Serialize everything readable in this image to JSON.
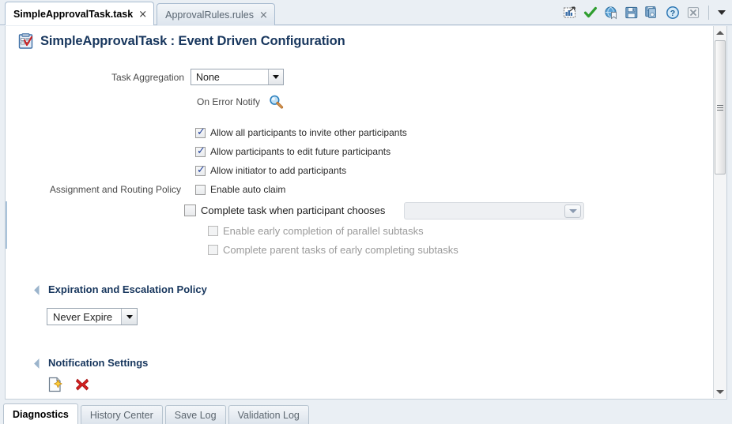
{
  "window": {
    "document_tabs": [
      {
        "label": "SimpleApprovalTask.task",
        "close": "×",
        "active": true
      },
      {
        "label": "ApprovalRules.rules",
        "close": "×",
        "active": false
      }
    ],
    "toolbar_icons": [
      {
        "name": "deploy-icon",
        "title": "Deploy"
      },
      {
        "name": "validate-checkmark-icon",
        "title": "Validate"
      },
      {
        "name": "globe-bookmark-icon",
        "title": "Preview in Browser"
      },
      {
        "name": "save-icon",
        "title": "Save"
      },
      {
        "name": "save-all-icon",
        "title": "Save All"
      },
      {
        "name": "help-icon",
        "title": "Help"
      },
      {
        "name": "close-icon",
        "title": "Close"
      },
      {
        "name": "overflow-chevron-icon",
        "title": "More"
      }
    ]
  },
  "page": {
    "icon": "task-clipboard-icon",
    "title": "SimpleApprovalTask : Event Driven Configuration"
  },
  "form": {
    "task_aggregation": {
      "label": "Task Aggregation",
      "value": "None"
    },
    "on_error_notify": {
      "label": "On Error Notify",
      "icon": "search-magnifier-icon"
    },
    "assignment_routing": {
      "label": "Assignment and Routing Policy",
      "checkboxes": [
        {
          "label": "Allow all participants to invite other participants",
          "checked": true,
          "disabled": false
        },
        {
          "label": "Allow participants to edit future participants",
          "checked": true,
          "disabled": false
        },
        {
          "label": "Allow initiator to add participants",
          "checked": true,
          "disabled": false
        },
        {
          "label": "Enable auto claim",
          "checked": false,
          "disabled": false
        }
      ],
      "complete_task": {
        "label": "Complete task when participant chooses",
        "checked": false,
        "dropdown_value": "",
        "dropdown_disabled": true
      },
      "sub_checkboxes": [
        {
          "label": "Enable early completion of parallel subtasks",
          "checked": false,
          "disabled": true
        },
        {
          "label": "Complete parent tasks of early completing subtasks",
          "checked": false,
          "disabled": true
        }
      ]
    }
  },
  "sections": {
    "expiration": {
      "title": "Expiration and Escalation Policy",
      "expire_value": "Never Expire"
    },
    "notification": {
      "title": "Notification Settings",
      "actions": [
        {
          "name": "add-notification-icon",
          "title": "Add"
        },
        {
          "name": "delete-notification-icon",
          "title": "Delete"
        }
      ]
    }
  },
  "scrollbar": {
    "up_arrow": "scroll-up-icon",
    "down_arrow": "scroll-down-icon"
  },
  "bottom_tabs": [
    {
      "label": "Diagnostics",
      "active": true
    },
    {
      "label": "History Center",
      "active": false
    },
    {
      "label": "Save Log",
      "active": false
    },
    {
      "label": "Validation Log",
      "active": false
    }
  ],
  "colors": {
    "title_blue": "#17365d",
    "tab_strip": "#eaeff4",
    "accent": "#a9c3da"
  }
}
